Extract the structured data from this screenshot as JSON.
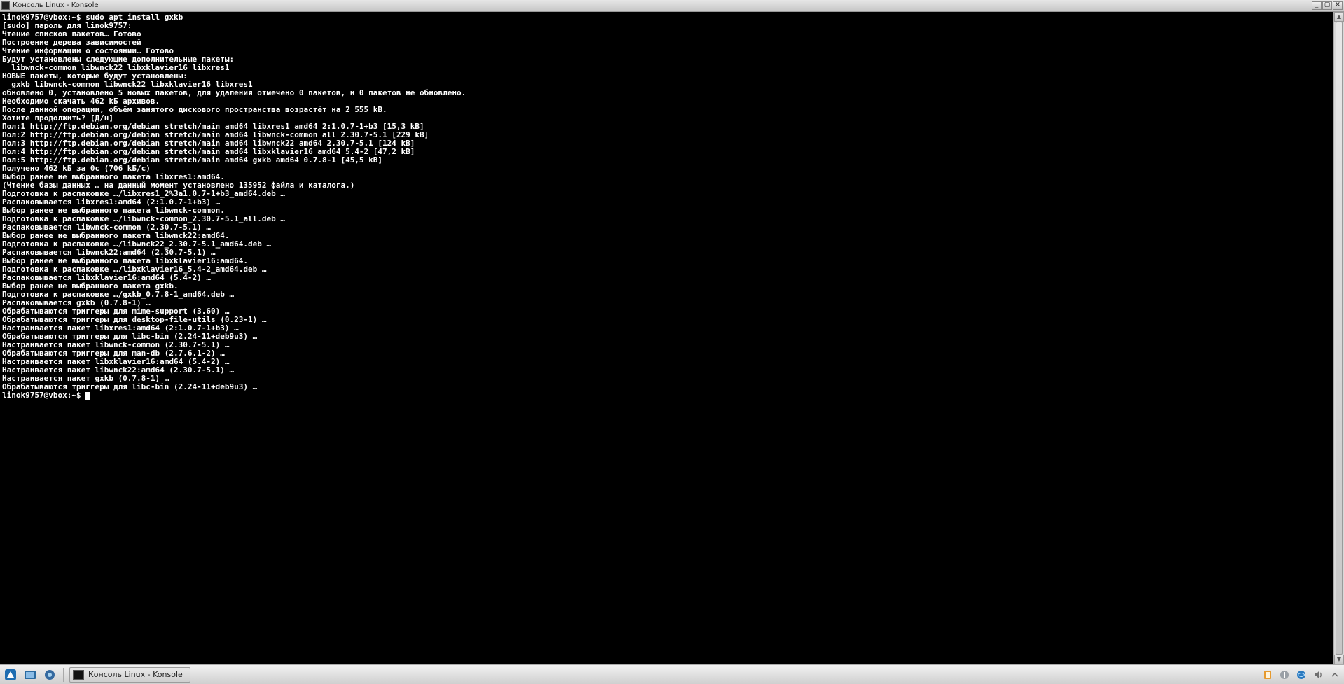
{
  "window": {
    "title": "Консоль Linux - Konsole"
  },
  "terminal": {
    "prompt1": "linok9757@vbox:~$ ",
    "cmd1": "sudo apt install gxkb",
    "lines": [
      "[sudo] пароль для linok9757:",
      "Чтение списков пакетов… Готово",
      "Построение дерева зависимостей",
      "Чтение информации о состоянии… Готово",
      "Будут установлены следующие дополнительные пакеты:",
      "  libwnck-common libwnck22 libxklavier16 libxres1",
      "НОВЫЕ пакеты, которые будут установлены:",
      "  gxkb libwnck-common libwnck22 libxklavier16 libxres1",
      "обновлено 0, установлено 5 новых пакетов, для удаления отмечено 0 пакетов, и 0 пакетов не обновлено.",
      "Необходимо скачать 462 kБ архивов.",
      "После данной операции, объём занятого дискового пространства возрастёт на 2 555 kB.",
      "Хотите продолжить? [Д/н]",
      "Пол:1 http://ftp.debian.org/debian stretch/main amd64 libxres1 amd64 2:1.0.7-1+b3 [15,3 kB]",
      "Пол:2 http://ftp.debian.org/debian stretch/main amd64 libwnck-common all 2.30.7-5.1 [229 kB]",
      "Пол:3 http://ftp.debian.org/debian stretch/main amd64 libwnck22 amd64 2.30.7-5.1 [124 kB]",
      "Пол:4 http://ftp.debian.org/debian stretch/main amd64 libxklavier16 amd64 5.4-2 [47,2 kB]",
      "Пол:5 http://ftp.debian.org/debian stretch/main amd64 gxkb amd64 0.7.8-1 [45,5 kB]",
      "Получено 462 kБ за 0с (706 kБ/c)",
      "Выбор ранее не выбранного пакета libxres1:amd64.",
      "(Чтение базы данных … на данный момент установлено 135952 файла и каталога.)",
      "Подготовка к распаковке …/libxres1_2%3a1.0.7-1+b3_amd64.deb …",
      "Распаковывается libxres1:amd64 (2:1.0.7-1+b3) …",
      "Выбор ранее не выбранного пакета libwnck-common.",
      "Подготовка к распаковке …/libwnck-common_2.30.7-5.1_all.deb …",
      "Распаковывается libwnck-common (2.30.7-5.1) …",
      "Выбор ранее не выбранного пакета libwnck22:amd64.",
      "Подготовка к распаковке …/libwnck22_2.30.7-5.1_amd64.deb …",
      "Распаковывается libwnck22:amd64 (2.30.7-5.1) …",
      "Выбор ранее не выбранного пакета libxklavier16:amd64.",
      "Подготовка к распаковке …/libxklavier16_5.4-2_amd64.deb …",
      "Распаковывается libxklavier16:amd64 (5.4-2) …",
      "Выбор ранее не выбранного пакета gxkb.",
      "Подготовка к распаковке …/gxkb_0.7.8-1_amd64.deb …",
      "Распаковывается gxkb (0.7.8-1) …",
      "Обрабатываются триггеры для mime-support (3.60) …",
      "Обрабатываются триггеры для desktop-file-utils (0.23-1) …",
      "Настраивается пакет libxres1:amd64 (2:1.0.7-1+b3) …",
      "Обрабатываются триггеры для libc-bin (2.24-11+deb9u3) …",
      "Настраивается пакет libwnck-common (2.30.7-5.1) …",
      "Обрабатываются триггеры для man-db (2.7.6.1-2) …",
      "Настраивается пакет libxklavier16:amd64 (5.4-2) …",
      "Настраивается пакет libwnck22:amd64 (2.30.7-5.1) …",
      "Настраивается пакет gxkb (0.7.8-1) …",
      "Обрабатываются триггеры для libc-bin (2.24-11+deb9u3) …"
    ],
    "prompt2": "linok9757@vbox:~$ "
  },
  "taskbar": {
    "task_label": "Консоль Linux - Konsole"
  }
}
